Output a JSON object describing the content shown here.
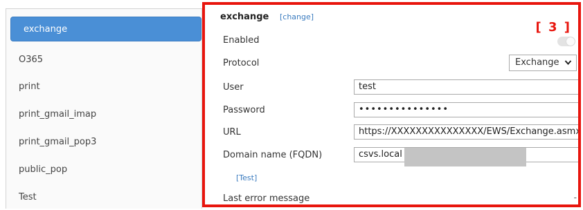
{
  "sidebar": {
    "items": [
      {
        "label": "exchange",
        "active": true
      },
      {
        "label": "O365"
      },
      {
        "label": "print"
      },
      {
        "label": "print_gmail_imap"
      },
      {
        "label": "print_gmail_pop3"
      },
      {
        "label": "public_pop"
      },
      {
        "label": "Test"
      }
    ]
  },
  "panel": {
    "title": "exchange",
    "change_link": "[change]",
    "step_label": "[ 3 ]",
    "enabled": {
      "label": "Enabled",
      "value": false
    },
    "protocol": {
      "label": "Protocol",
      "value": "Exchange"
    },
    "user": {
      "label": "User",
      "value": "test"
    },
    "password": {
      "label": "Password",
      "value": "•••••••••••••••"
    },
    "url": {
      "label": "URL",
      "value": "https://XXXXXXXXXXXXXXX/EWS/Exchange.asmx"
    },
    "domain": {
      "label": "Domain name (FQDN)",
      "value": "csvs.local"
    },
    "test_link": "[Test]",
    "last_error": {
      "label": "Last error message",
      "value": "-"
    }
  },
  "colors": {
    "accent": "#4a8fd6",
    "highlight_border": "#e8150d",
    "link": "#3a7bbf"
  },
  "icons": {
    "protocol_dropdown": "chevron-down-icon"
  }
}
